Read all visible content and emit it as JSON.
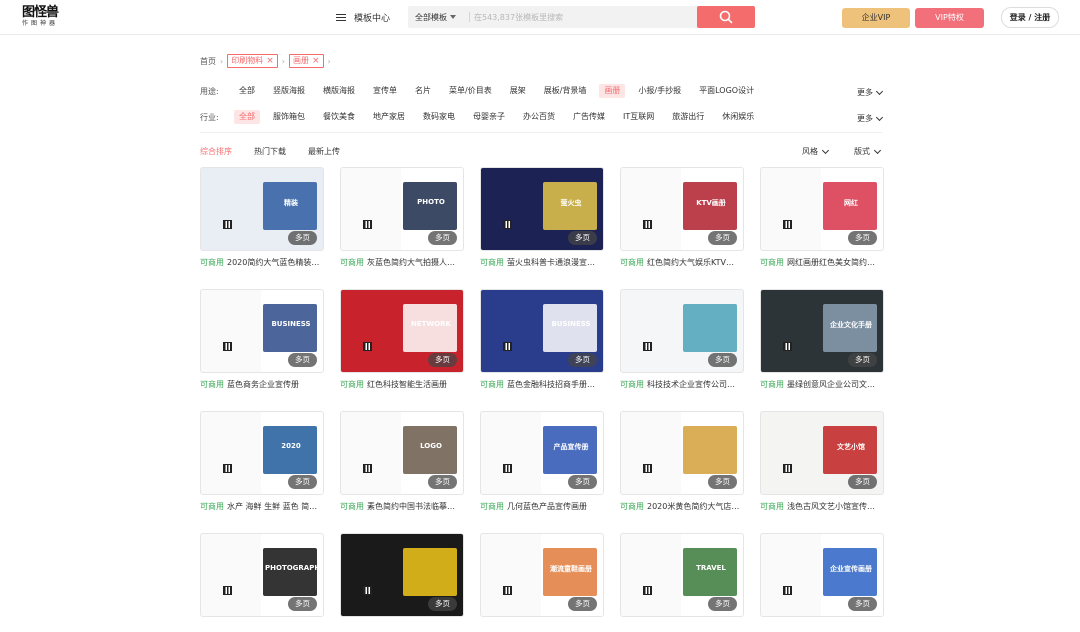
{
  "header": {
    "logo_main": "图怪兽",
    "logo_sub": "作图神器",
    "template_center": "模板中心",
    "search": {
      "category": "全部模板",
      "placeholder": "在543,837张模板里搜索"
    },
    "vip": "企业VIP",
    "vip2": "VIP特权",
    "login": "登录 / 注册"
  },
  "breadcrumb": {
    "home": "首页",
    "tags": [
      "印刷物料",
      "画册"
    ]
  },
  "filters": {
    "use": {
      "label": "用途:",
      "options": [
        "全部",
        "竖版海报",
        "横版海报",
        "宣传单",
        "名片",
        "菜单/价目表",
        "展架",
        "展板/背景墙",
        "画册",
        "小报/手抄报",
        "平面LOGO设计"
      ],
      "active": 8
    },
    "industry": {
      "label": "行业:",
      "options": [
        "全部",
        "服饰箱包",
        "餐饮美食",
        "地产家居",
        "数码家电",
        "母婴亲子",
        "办公百货",
        "广告传媒",
        "IT互联网",
        "旅游出行",
        "休闲娱乐"
      ],
      "active": 0
    },
    "more": "更多"
  },
  "sort": {
    "options": [
      "综合排序",
      "热门下载",
      "最新上传"
    ],
    "active": 0,
    "style": "风格",
    "layout": "版式"
  },
  "cards": [
    {
      "title": "2020简约大气蓝色精装…",
      "commercial": "可商用",
      "pages": "多页",
      "bg": "#e8eef4",
      "accent": "#2c5aa0",
      "thumb_text": "精装"
    },
    {
      "title": "灰蓝色简约大气拍摄人…",
      "commercial": "可商用",
      "pages": "多页",
      "bg": "#ffffff",
      "accent": "#1a2a4a",
      "thumb_text": "PHOTO"
    },
    {
      "title": "萤火虫科普卡通浪漫宣…",
      "commercial": "可商用",
      "pages": "多页",
      "bg": "#1c2254",
      "accent": "#e8c84a",
      "thumb_text": "萤火虫"
    },
    {
      "title": "红色简约大气娱乐KTV…",
      "commercial": "可商用",
      "pages": "多页",
      "bg": "#ffffff",
      "accent": "#b01f2c",
      "thumb_text": "KTV画册"
    },
    {
      "title": "网红画册红色美女简约…",
      "commercial": "可商用",
      "pages": "多页",
      "bg": "#ffffff",
      "accent": "#d8334a",
      "thumb_text": "网红"
    },
    {
      "title": "蓝色商务企业宣传册",
      "commercial": "可商用",
      "pages": "多页",
      "bg": "#ffffff",
      "accent": "#2d4a8a",
      "thumb_text": "BUSINESS"
    },
    {
      "title": "红色科技智能生活画册",
      "commercial": "可商用",
      "pages": "多页",
      "bg": "#c8222d",
      "accent": "#ffffff",
      "thumb_text": "NETWORK"
    },
    {
      "title": "蓝色金融科技招商手册…",
      "commercial": "可商用",
      "pages": "多页",
      "bg": "#2a3c8c",
      "accent": "#ffffff",
      "thumb_text": "BUSINESS"
    },
    {
      "title": "科技技术企业宣传公司…",
      "commercial": "可商用",
      "pages": "多页",
      "bg": "#f4f6f7",
      "accent": "#4aa2b8",
      "thumb_text": ""
    },
    {
      "title": "墨绿创意风企业公司文…",
      "commercial": "可商用",
      "pages": "多页",
      "bg": "#2c3438",
      "accent": "#8aa0b4",
      "thumb_text": "企业文化手册"
    },
    {
      "title": "水产 海鲜 生鲜 蓝色 简…",
      "commercial": "可商用",
      "pages": "多页",
      "bg": "#ffffff",
      "accent": "#1e5a9a",
      "thumb_text": "2020"
    },
    {
      "title": "素色简约中国书法临摹…",
      "commercial": "可商用",
      "pages": "多页",
      "bg": "#ffffff",
      "accent": "#6a5a4a",
      "thumb_text": "LOGO"
    },
    {
      "title": "几何蓝色产品宣传画册",
      "commercial": "可商用",
      "pages": "多页",
      "bg": "#ffffff",
      "accent": "#2a52b4",
      "thumb_text": "产品宣传册"
    },
    {
      "title": "2020米黄色简约大气店…",
      "commercial": "可商用",
      "pages": "多页",
      "bg": "#ffffff",
      "accent": "#d4a03a",
      "thumb_text": ""
    },
    {
      "title": "浅色古风文艺小馆宣传…",
      "commercial": "可商用",
      "pages": "多页",
      "bg": "#f4f4f2",
      "accent": "#c02020",
      "thumb_text": "文艺小馆"
    },
    {
      "title": "",
      "commercial": "",
      "pages": "多页",
      "bg": "#ffffff",
      "accent": "#111111",
      "thumb_text": "PHOTOGRAPHY"
    },
    {
      "title": "",
      "commercial": "",
      "pages": "多页",
      "bg": "#1a1a1a",
      "accent": "#f2c81a",
      "thumb_text": ""
    },
    {
      "title": "",
      "commercial": "",
      "pages": "多页",
      "bg": "#ffffff",
      "accent": "#e07a3a",
      "thumb_text": "潮流童鞋画册"
    },
    {
      "title": "",
      "commercial": "",
      "pages": "多页",
      "bg": "#ffffff",
      "accent": "#3a7a3a",
      "thumb_text": "TRAVEL"
    },
    {
      "title": "",
      "commercial": "",
      "pages": "多页",
      "bg": "#ffffff",
      "accent": "#2a62c4",
      "thumb_text": "企业宣传画册"
    }
  ]
}
